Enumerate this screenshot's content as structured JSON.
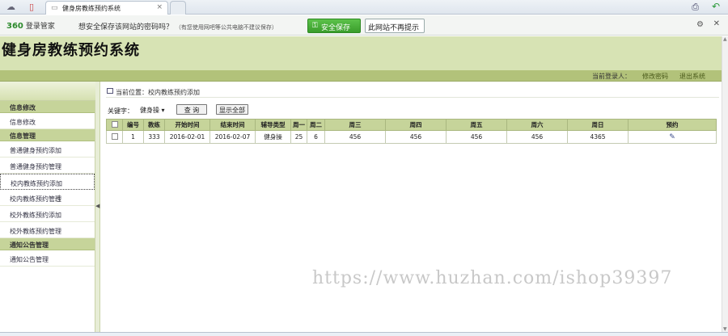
{
  "browser": {
    "tab_title": "健身房教练预约系统",
    "tab_close": "×",
    "save_bar": {
      "logo_num": "360",
      "logo_text": "登录管家",
      "question": "想安全保存该网站的密码吗？",
      "note": "（有您使用网吧等公共电脑不建议保存）",
      "save_button": "安全保存",
      "no_prompt_button": "此网站不再提示"
    }
  },
  "app": {
    "title": "健身房教练预约系统",
    "user_label": "当前登录人：",
    "change_password": "修改密码",
    "logout": "退出系统"
  },
  "sidebar": {
    "groups": [
      {
        "label": "信息修改",
        "items": [
          "信息修改"
        ]
      },
      {
        "label": "信息管理",
        "items": [
          "普通健身预约添加",
          "普通健身预约管理",
          "校内教练预约添加",
          "校内教练预约管理",
          "校外教练预约添加",
          "校外教练预约管理"
        ]
      },
      {
        "label": "通知公告管理",
        "items": [
          "通知公告管理"
        ]
      }
    ],
    "active_item": "校内教练预约添加"
  },
  "content": {
    "breadcrumb": "当前位置：校内教练预约添加",
    "search": {
      "keyword_label": "关键字：",
      "selected_option": "健身操",
      "query_button": "查 询",
      "show_all_button": "显示全部"
    },
    "table": {
      "headers": [
        "",
        "编号",
        "教练",
        "开始时间",
        "结束时间",
        "辅导类型",
        "周一",
        "周二",
        "周三",
        "周四",
        "周五",
        "周六",
        "周日",
        "预约"
      ],
      "rows": [
        [
          "",
          "1",
          "333",
          "2016-02-01",
          "2016-02-07",
          "健身操",
          "25",
          "6",
          "456",
          "456",
          "456",
          "456",
          "4365",
          ""
        ]
      ]
    }
  },
  "watermark": "https://www.huzhan.com/ishop39397",
  "colors": {
    "header_bg": "#d7e3b4",
    "bar_bg": "#b2c27a",
    "table_head": "#c6d49a",
    "save_green": "#3a9d2c"
  }
}
